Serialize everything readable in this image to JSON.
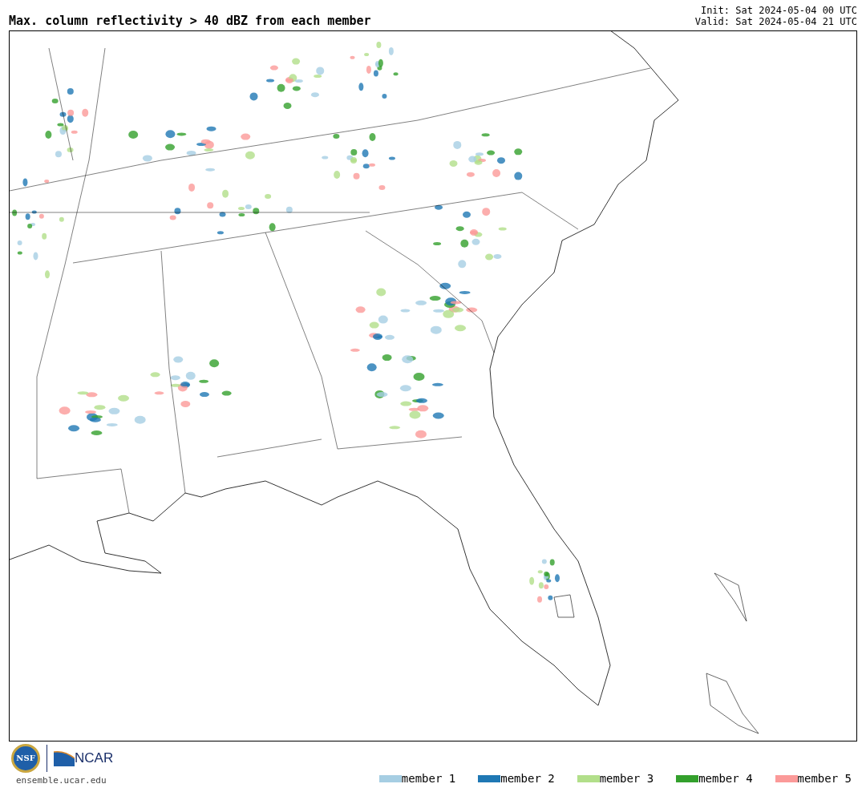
{
  "title": "Max. column reflectivity > 40 dBZ from each member",
  "init": "Init: Sat 2024-05-04 00 UTC",
  "valid": "Valid: Sat 2024-05-04 21 UTC",
  "logos": {
    "nsf": "NSF",
    "ncar": "NCAR",
    "url": "ensemble.ucar.edu"
  },
  "legend": [
    {
      "label": "member 1",
      "color": "#a6cee3"
    },
    {
      "label": "member 2",
      "color": "#1f78b4"
    },
    {
      "label": "member 3",
      "color": "#b2df8a"
    },
    {
      "label": "member 4",
      "color": "#33a02c"
    },
    {
      "label": "member 5",
      "color": "#fb9a99"
    }
  ]
}
